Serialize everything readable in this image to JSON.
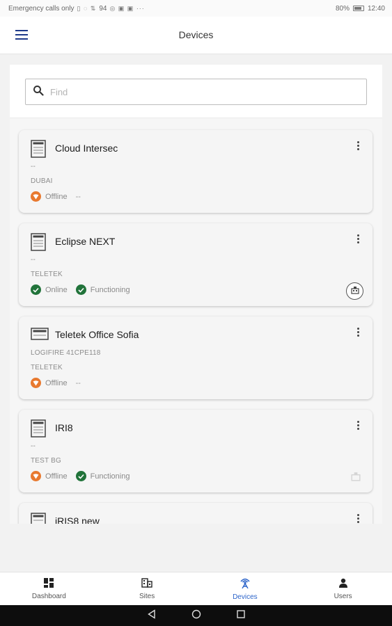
{
  "status_bar": {
    "carrier_text": "Emergency calls only",
    "speed": "94",
    "battery_level": "80%",
    "time": "12:40"
  },
  "app_bar": {
    "title": "Devices"
  },
  "search": {
    "placeholder": "Find",
    "value": ""
  },
  "devices": [
    {
      "name": "Cloud Intersec",
      "model": "--",
      "site": "DUBAI",
      "connection": "Offline",
      "state": "--",
      "has_site_button": false
    },
    {
      "name": "Eclipse NEXT",
      "model": "--",
      "site": "TELETEK",
      "connection": "Online",
      "state": "Functioning",
      "has_site_button": true
    },
    {
      "name": "Teletek Office Sofia",
      "model": "LOGIFIRE 41CPE118",
      "site": "TELETEK",
      "connection": "Offline",
      "state": "--",
      "has_site_button": false
    },
    {
      "name": "IRI8",
      "model": "--",
      "site": "TEST BG",
      "connection": "Offline",
      "state": "Functioning",
      "has_site_button": false
    },
    {
      "name": "iRIS8 new"
    }
  ],
  "bottom_nav": {
    "items": [
      {
        "label": "Dashboard",
        "icon": "dashboard-icon"
      },
      {
        "label": "Sites",
        "icon": "building-icon"
      },
      {
        "label": "Devices",
        "icon": "antenna-icon",
        "active": true
      },
      {
        "label": "Users",
        "icon": "person-icon"
      }
    ]
  },
  "colors": {
    "accent": "#2b63c9",
    "menu_icon": "#1f3a8a",
    "offline": "#e8792f",
    "online": "#21733a"
  }
}
